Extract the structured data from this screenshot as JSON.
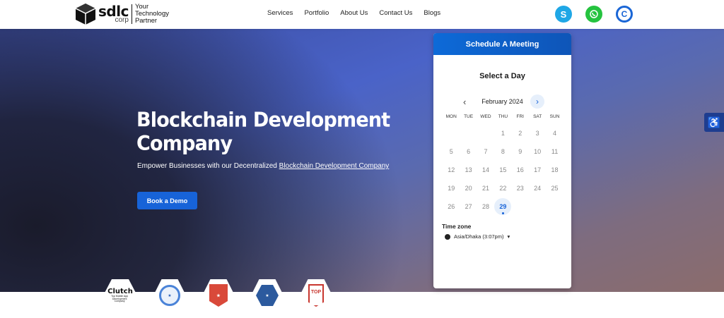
{
  "header": {
    "logo_main": "sdlc",
    "logo_corp": "corp",
    "logo_tagline_1": "Your",
    "logo_tagline_2": "Technology",
    "logo_tagline_3": "Partner",
    "nav": [
      "Services",
      "Portfolio",
      "About Us",
      "Contact Us",
      "Blogs"
    ],
    "social_icons": [
      "skype-icon",
      "whatsapp-icon",
      "calendly-icon"
    ],
    "colors": {
      "skype": "#1fa7e6",
      "whatsapp": "#25c33f",
      "calendly": "#1a66d6"
    }
  },
  "hero": {
    "title": "Blockchain Development Company",
    "subtitle_prefix": "Empower Businesses with our Decentralized ",
    "subtitle_link": "Blockchain Development Company",
    "cta_label": "Book a Demo",
    "colors": {
      "cta": "#1763d8"
    }
  },
  "badges": [
    {
      "name": "clutch-badge",
      "label": "Clutch",
      "sub": "Top Mobile App Development Company"
    },
    {
      "name": "goodfirms-badge"
    },
    {
      "name": "appfutura-badge"
    },
    {
      "name": "mobile-app-daily-badge"
    },
    {
      "name": "top-app-development-badge",
      "label": "TOP"
    }
  ],
  "scheduler": {
    "header": "Schedule A Meeting",
    "title": "Select a Day",
    "month": "February 2024",
    "weekdays": [
      "MON",
      "TUE",
      "WED",
      "THU",
      "FRI",
      "SAT",
      "SUN"
    ],
    "days": [
      "",
      "",
      "",
      "1",
      "2",
      "3",
      "4",
      "5",
      "6",
      "7",
      "8",
      "9",
      "10",
      "11",
      "12",
      "13",
      "14",
      "15",
      "16",
      "17",
      "18",
      "19",
      "20",
      "21",
      "22",
      "23",
      "24",
      "25",
      "26",
      "27",
      "28",
      "29",
      "",
      "",
      ""
    ],
    "selected_day": "29",
    "timezone_label": "Time zone",
    "timezone_value": "Asia/Dhaka (3:07pm)",
    "colors": {
      "header": "#0d6ad8",
      "accent": "#1763d8"
    }
  },
  "accessibility": {
    "icon": "accessibility-icon"
  }
}
